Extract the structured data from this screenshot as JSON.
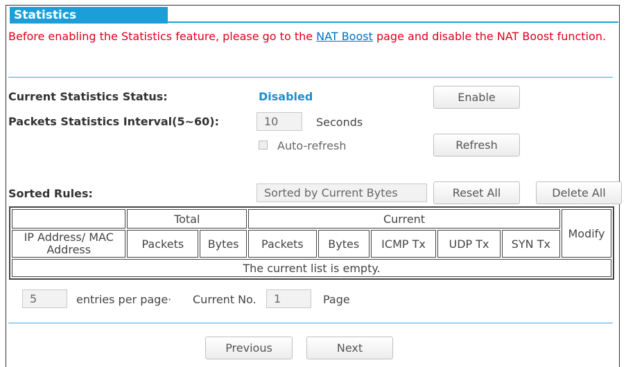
{
  "header": {
    "title": "Statistics"
  },
  "warning": {
    "before": "Before enabling the Statistics feature, please go to the ",
    "link": "NAT Boost",
    "after": " page and disable the NAT Boost function."
  },
  "status": {
    "label": "Current Statistics Status:",
    "value": "Disabled",
    "enable_button": "Enable"
  },
  "interval": {
    "label": "Packets Statistics Interval(5~60):",
    "value": "10",
    "unit": "Seconds",
    "auto_refresh_label": "Auto-refresh",
    "auto_refresh_checked": false,
    "refresh_button": "Refresh"
  },
  "sorted": {
    "label": "Sorted Rules:",
    "select_value": "Sorted by Current Bytes",
    "reset_all_button": "Reset All",
    "delete_all_button": "Delete All"
  },
  "table": {
    "group_total": "Total",
    "group_current": "Current",
    "modify": "Modify",
    "col_ip": "IP Address/ MAC Address",
    "cols": [
      "Packets",
      "Bytes",
      "Packets",
      "Bytes",
      "ICMP Tx",
      "UDP Tx",
      "SYN Tx"
    ],
    "empty_message": "The current list is empty."
  },
  "pager": {
    "entries_value": "5",
    "entries_label": "entries per page·",
    "current_label": "Current No.",
    "current_value": "1",
    "page_label": "Page",
    "previous_button": "Previous",
    "next_button": "Next"
  },
  "colors": {
    "accent": "#1c9fd9",
    "warning": "#e0001b",
    "link": "#0070c0",
    "status": "#1c8fd0"
  }
}
